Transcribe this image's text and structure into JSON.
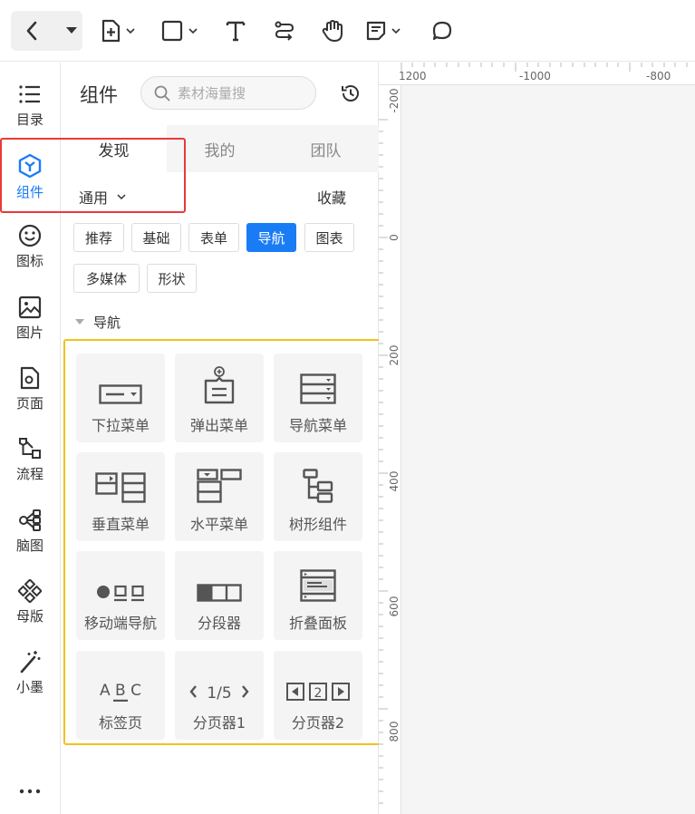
{
  "panel": {
    "title": "组件",
    "search_placeholder": "素材海量搜",
    "tabs": [
      "发现",
      "我的",
      "团队"
    ],
    "filter_label": "通用",
    "favorites_label": "收藏",
    "chips": [
      "推荐",
      "基础",
      "表单",
      "导航",
      "图表",
      "多媒体",
      "形状"
    ],
    "active_chip": "导航",
    "section_title": "导航",
    "components": [
      {
        "label": "下拉菜单",
        "icon": "dropdown-menu-icon"
      },
      {
        "label": "弹出菜单",
        "icon": "popup-menu-icon"
      },
      {
        "label": "导航菜单",
        "icon": "nav-menu-icon"
      },
      {
        "label": "垂直菜单",
        "icon": "vertical-menu-icon"
      },
      {
        "label": "水平菜单",
        "icon": "horizontal-menu-icon"
      },
      {
        "label": "树形组件",
        "icon": "tree-icon"
      },
      {
        "label": "移动端导航",
        "icon": "mobile-nav-icon"
      },
      {
        "label": "分段器",
        "icon": "segmented-control-icon"
      },
      {
        "label": "折叠面板",
        "icon": "collapse-panel-icon"
      },
      {
        "label": "标签页",
        "icon": "tabs-icon",
        "icon_text": "A B C"
      },
      {
        "label": "分页器1",
        "icon": "pagination-icon",
        "icon_text": "1/5"
      },
      {
        "label": "分页器2",
        "icon": "pagination-2-icon",
        "icon_text": "2"
      }
    ]
  },
  "leftnav": {
    "items": [
      {
        "label": "目录",
        "icon": "list-icon"
      },
      {
        "label": "组件",
        "icon": "component-icon"
      },
      {
        "label": "图标",
        "icon": "smiley-icon"
      },
      {
        "label": "图片",
        "icon": "image-icon"
      },
      {
        "label": "页面",
        "icon": "page-icon"
      },
      {
        "label": "流程",
        "icon": "flow-icon"
      },
      {
        "label": "脑图",
        "icon": "mindmap-icon"
      },
      {
        "label": "母版",
        "icon": "master-icon"
      },
      {
        "label": "小墨",
        "icon": "magic-wand-icon"
      }
    ],
    "active": "组件",
    "more_label": "..."
  },
  "ruler": {
    "top": [
      "1200",
      "-1000",
      "-800"
    ],
    "left": [
      "-200",
      "0",
      "200",
      "400",
      "600",
      "800"
    ]
  },
  "colors": {
    "accent": "#1a7cf5",
    "highlight_red": "#e83a3a",
    "highlight_yellow": "#f2c21b"
  }
}
